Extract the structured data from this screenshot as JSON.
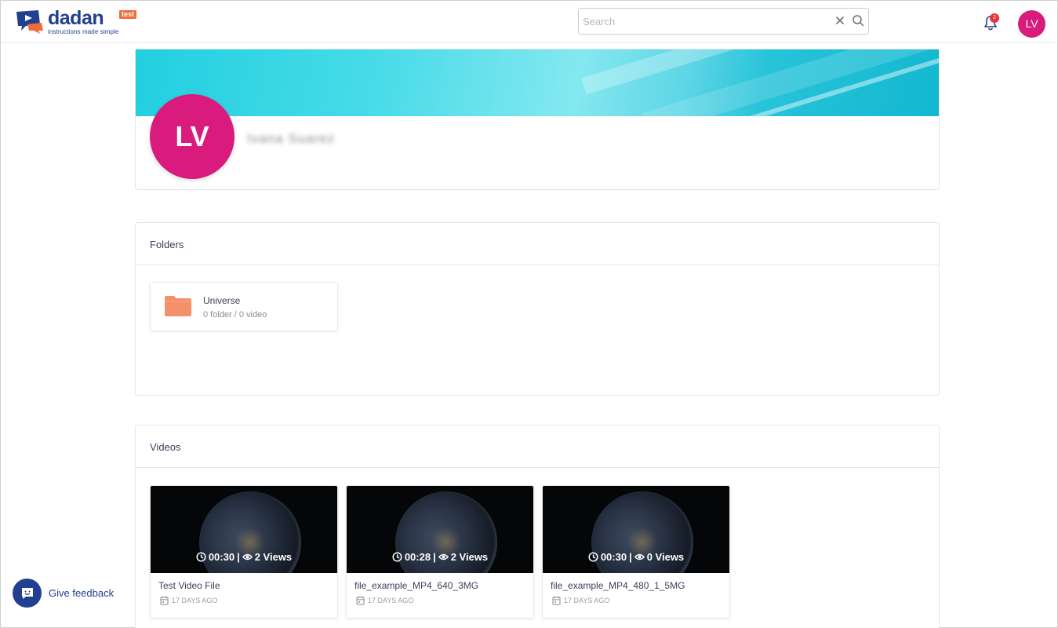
{
  "header": {
    "logo_word": "dadan",
    "logo_badge": "test",
    "logo_tagline": "instructions made simple",
    "search_placeholder": "Search",
    "notification_count": "2",
    "user_initials": "LV"
  },
  "profile": {
    "initials": "LV",
    "name": "Ivana Suarez"
  },
  "folders": {
    "title": "Folders",
    "items": [
      {
        "name": "Universe",
        "meta": "0 folder / 0 video"
      }
    ]
  },
  "videos": {
    "title": "Videos",
    "items": [
      {
        "duration": "00:30",
        "views": "2 Views",
        "title": "Test Video File",
        "date": "17 DAYS AGO"
      },
      {
        "duration": "00:28",
        "views": "2 Views",
        "title": "file_example_MP4_640_3MG",
        "date": "17 DAYS AGO"
      },
      {
        "duration": "00:30",
        "views": "0 Views",
        "title": "file_example_MP4_480_1_5MG",
        "date": "17 DAYS AGO"
      }
    ]
  },
  "feedback": {
    "label": "Give feedback"
  },
  "colors": {
    "brand": "#233f8f",
    "accent": "#f26b3a",
    "avatar": "#d81b7d",
    "folder": "#f4916a",
    "badge": "#e7333b"
  }
}
